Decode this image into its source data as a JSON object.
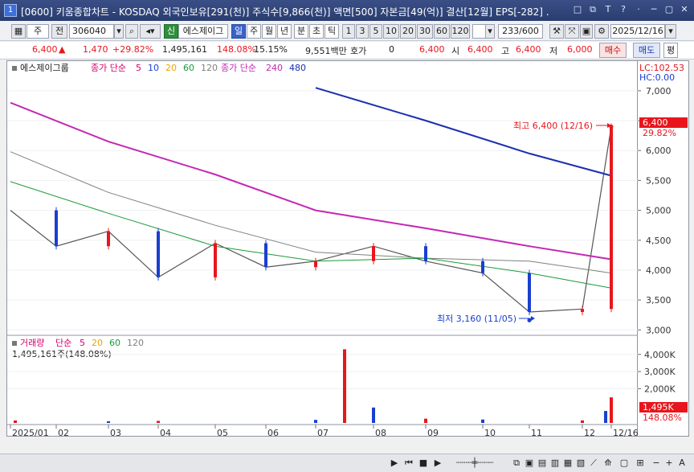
{
  "window": {
    "number": "1",
    "title": "[0600] 키움종합차트 - KOSDAQ 외국인보유[291(천)] 주식수[9,866(천)] 액면[500] 자본금[49(억)] 결산[12월] EPS[-282] .",
    "buttons": [
      "□",
      "⧉",
      "T",
      "?",
      "·",
      "─",
      "▢",
      "✕"
    ]
  },
  "toolbar": {
    "mode": "주",
    "prev": "전",
    "code": "306040",
    "badge": "신",
    "stock_name": "에스제이그",
    "periods": [
      "일",
      "주",
      "월",
      "년",
      "분",
      "초",
      "틱"
    ],
    "selected_period": "일",
    "intervals": [
      "1",
      "3",
      "5",
      "10",
      "20",
      "30",
      "60",
      "120"
    ],
    "count": "233/600",
    "date": "2025/12/16"
  },
  "quote": {
    "price": "6,400",
    "change": "1,470",
    "change_pct": "+29.82%",
    "volume": "1,495,161",
    "vol_ratio": "148.08%",
    "turnover": "15.15%",
    "amount": "9,551백만",
    "hoga_label": "호가",
    "hoga_value": "0",
    "ask": "6,400",
    "open_label": "시",
    "open": "6,400",
    "high_label": "고",
    "high": "6,400",
    "low_label": "저",
    "low": "6,000",
    "buy": "매수",
    "sell": "매도",
    "eval": "평"
  },
  "legend": {
    "name": "에스제이그룹",
    "ma_label": "종가 단순",
    "ma_periods": [
      "5",
      "10",
      "20",
      "60",
      "120"
    ],
    "ma_colors": [
      "#d4006f",
      "#1a3fd0",
      "#e8a500",
      "#1a9a3a",
      "#808080"
    ],
    "ma2_label": "종가 단순",
    "ma2_periods": [
      "240",
      "480"
    ],
    "ma2_colors": [
      "#c428b4",
      "#1a2fb0"
    ],
    "lc": "LC:102.53",
    "hc": "HC:0.00"
  },
  "volume_legend": {
    "name": "거래량",
    "ma_label": "단순",
    "ma_periods": [
      "5",
      "20",
      "60",
      "120"
    ],
    "ma_colors": [
      "#d4006f",
      "#e8a500",
      "#1a9a3a",
      "#808080"
    ],
    "current": "1,495,161주(148.08%)"
  },
  "annotations": {
    "high": "최고 6,400 (12/16)",
    "low": "최저 3,160 (11/05)"
  },
  "price_tag": {
    "price": "6,400",
    "pct": "29.82%"
  },
  "volume_tag": {
    "value": "1,495K",
    "pct": "148.08%"
  },
  "chart_data": [
    {
      "type": "line",
      "title": "에스제이그룹 일봉",
      "x_labels": [
        "2025/01",
        "02",
        "03",
        "04",
        "05",
        "06",
        "07",
        "08",
        "09",
        "10",
        "11",
        "12",
        "12/16"
      ],
      "y_ticks": [
        3000,
        3500,
        4000,
        4500,
        5000,
        5500,
        6000,
        6500,
        7000
      ],
      "ylim": [
        2950,
        7200
      ],
      "series": [
        {
          "name": "종가",
          "x": [
            "2025/01",
            "02",
            "03",
            "04",
            "05",
            "06",
            "07",
            "08",
            "09",
            "10",
            "11",
            "12",
            "12/16"
          ],
          "values": [
            5000,
            4400,
            4650,
            3880,
            4450,
            4050,
            4150,
            4400,
            4150,
            3950,
            3300,
            3350,
            6400
          ]
        },
        {
          "name": "240",
          "x": [
            "2025/01",
            "03",
            "05",
            "07",
            "09",
            "11",
            "12/16"
          ],
          "values": [
            6800,
            6150,
            5600,
            5000,
            4700,
            4400,
            4180
          ]
        },
        {
          "name": "480",
          "x": [
            "07",
            "09",
            "11",
            "12/16"
          ],
          "values": [
            7050,
            6500,
            5950,
            5580
          ]
        },
        {
          "name": "120",
          "x": [
            "2025/01",
            "03",
            "05",
            "07",
            "09",
            "11",
            "12/16"
          ],
          "values": [
            5980,
            5300,
            4750,
            4300,
            4200,
            4150,
            3950
          ]
        },
        {
          "name": "60",
          "x": [
            "2025/01",
            "03",
            "05",
            "07",
            "09",
            "11",
            "12/16"
          ],
          "values": [
            5480,
            4950,
            4400,
            4150,
            4200,
            3950,
            3700
          ]
        }
      ],
      "high": 6400,
      "low": 3160
    },
    {
      "type": "bar",
      "title": "거래량",
      "y_ticks": [
        2000,
        3000,
        4000
      ],
      "y_unit": "K",
      "ylim": [
        0,
        4600
      ],
      "x": [
        "2025/01",
        "03",
        "04",
        "07",
        "07/15",
        "08",
        "09",
        "10",
        "12",
        "12/15",
        "12/16"
      ],
      "values": [
        150,
        100,
        120,
        180,
        4300,
        900,
        250,
        200,
        150,
        700,
        1495
      ]
    }
  ]
}
